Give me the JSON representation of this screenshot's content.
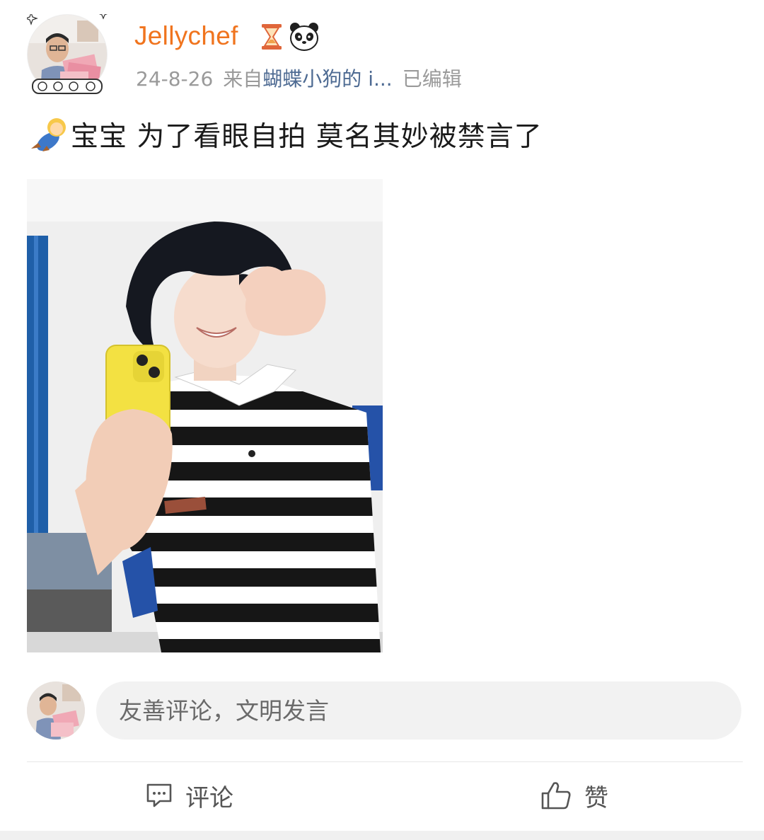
{
  "post": {
    "user": {
      "name": "Jellychef",
      "avatar": "avatar-photo",
      "badges": [
        "hourglass-icon",
        "panda-icon"
      ]
    },
    "meta": {
      "date": "24-8-26",
      "source_prefix": "来自",
      "source": "蝴蝶小狗的 i...",
      "edited": "已编辑"
    },
    "content": {
      "emoji": "baby-emoji",
      "text": "宝宝 为了看眼自拍 莫名其妙被禁言了"
    },
    "image": "selfie-photo"
  },
  "composer": {
    "placeholder": "友善评论，文明发言"
  },
  "actions": {
    "comment_label": "评论",
    "like_label": "赞"
  },
  "colors": {
    "username": "#f0741e",
    "source_link": "#4d6a92",
    "meta": "#9a9a9a"
  }
}
